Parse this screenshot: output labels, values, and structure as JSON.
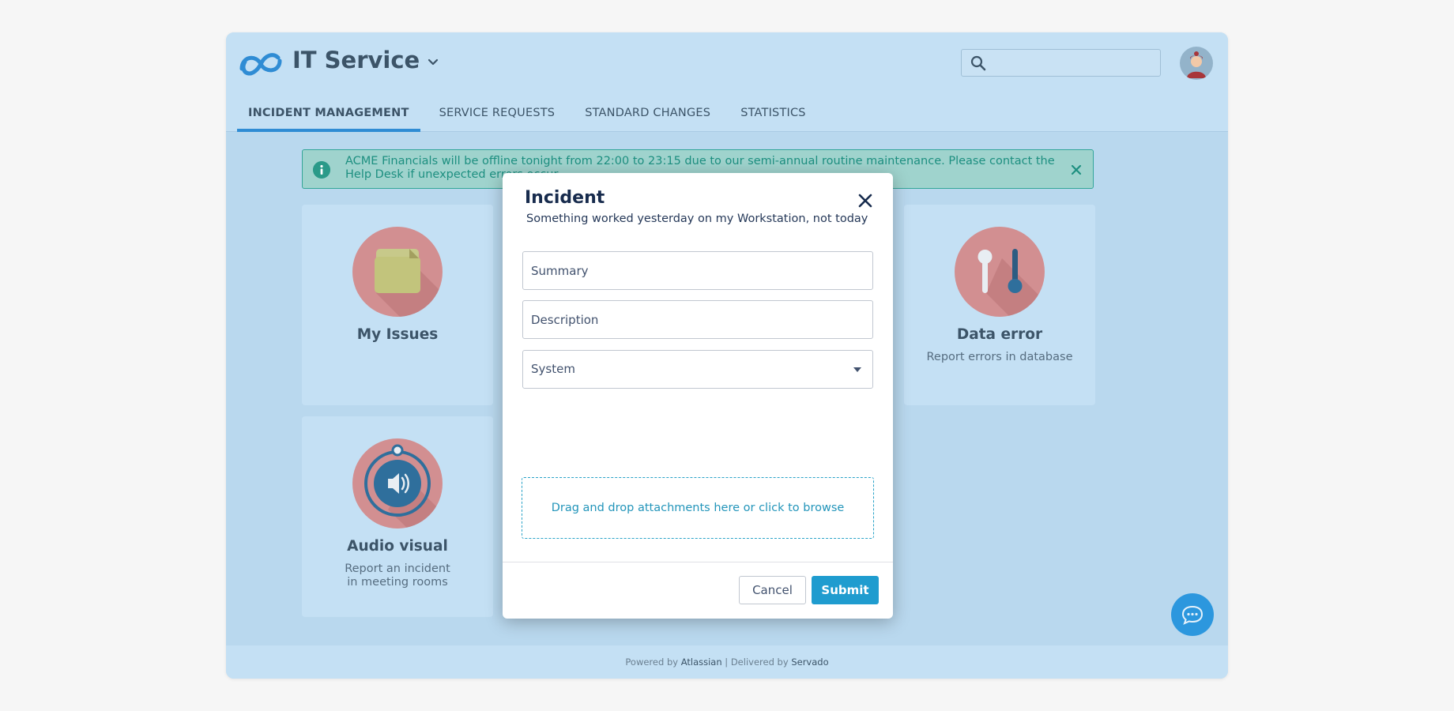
{
  "header": {
    "app_title": "IT Service",
    "logo_icon": "infinity-logo-icon",
    "search_placeholder": "",
    "tabs": [
      {
        "label": "INCIDENT MANAGEMENT",
        "active": true
      },
      {
        "label": "SERVICE REQUESTS",
        "active": false
      },
      {
        "label": "STANDARD CHANGES",
        "active": false
      },
      {
        "label": "STATISTICS",
        "active": false
      }
    ]
  },
  "notice": {
    "message": "ACME Financials will be offline tonight from 22:00 to 23:15 due to our semi-annual routine maintenance. Please contact the Help Desk if unexpected errors occur."
  },
  "cards": [
    {
      "title": "My Issues",
      "description": "",
      "icon": "folder-icon"
    },
    {
      "title": "Data error",
      "description": "Report errors in database",
      "icon": "thermometer-icon"
    },
    {
      "title": "Audio visual",
      "description_line1": "Report an incident",
      "description_line2": "in meeting rooms",
      "icon": "speaker-icon"
    }
  ],
  "modal": {
    "title": "Incident",
    "subtitle": "Something worked yesterday on my Workstation, not today",
    "summary_placeholder": "Summary",
    "description_placeholder": "Description",
    "system_value": "System",
    "dropzone_text": "Drag and drop attachments here or click to browse",
    "cancel_label": "Cancel",
    "submit_label": "Submit"
  },
  "footer": {
    "powered_by": "Powered by",
    "powered_name": "Atlassian",
    "separator": "|",
    "delivered_by": "Delivered by",
    "delivered_name": "Servado"
  },
  "colors": {
    "accent": "#2f8cd4",
    "submit": "#1f9ccf",
    "notice_text": "#1d8f80",
    "card_circle": "#d28f91"
  }
}
